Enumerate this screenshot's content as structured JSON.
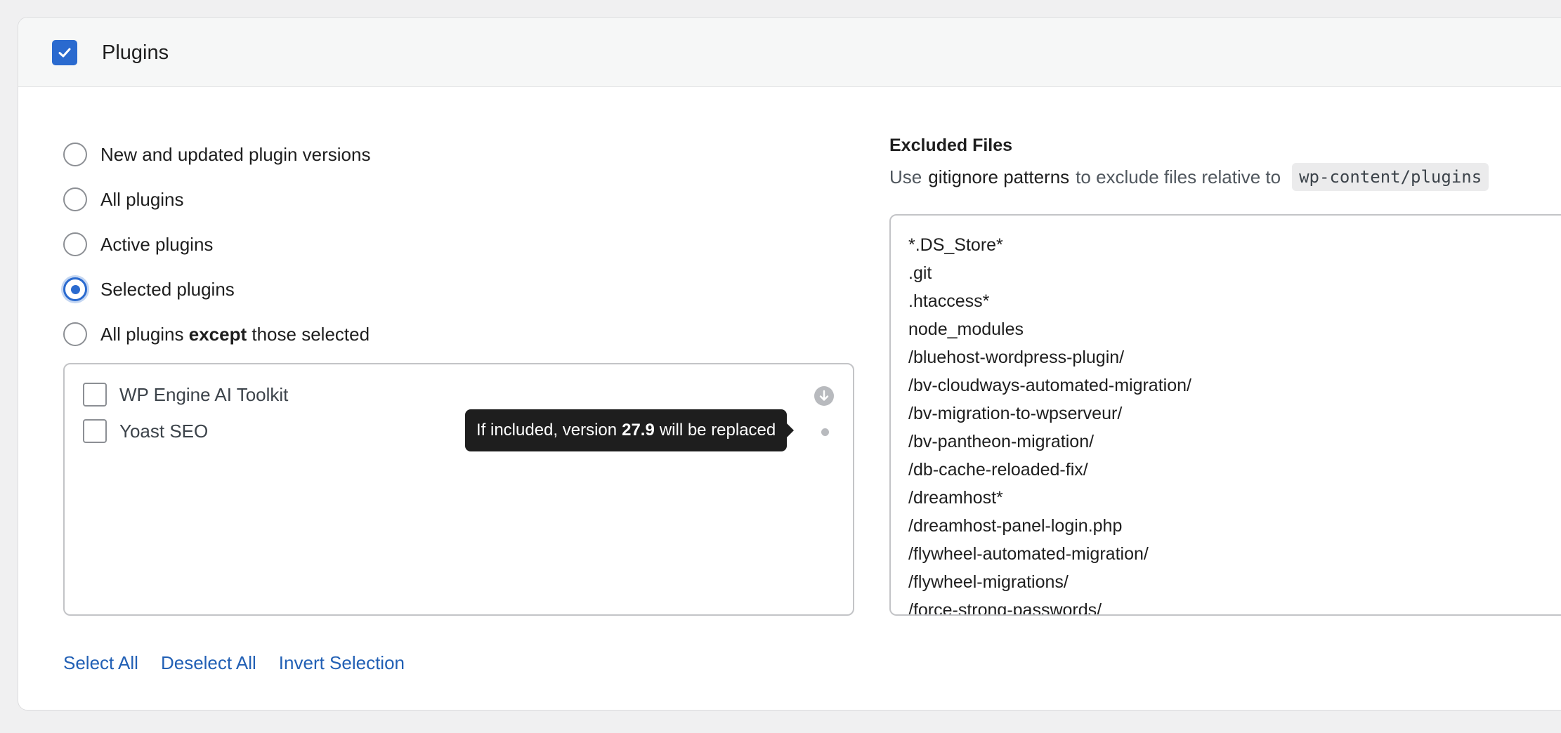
{
  "header": {
    "title": "Plugins",
    "checked": true
  },
  "mode_options": [
    {
      "label": "New and updated plugin versions",
      "selected": false
    },
    {
      "label": "All plugins",
      "selected": false
    },
    {
      "label": "Active plugins",
      "selected": false
    },
    {
      "label": "Selected plugins",
      "selected": true
    },
    {
      "label_before": "All plugins",
      "label_bold": "except",
      "label_after": "those selected",
      "selected": false
    }
  ],
  "plugins": [
    {
      "name": "WP Engine AI Toolkit",
      "checked": false,
      "icon": "download-circle-icon"
    },
    {
      "name": "Yoast SEO",
      "checked": false,
      "icon": "dot-icon"
    }
  ],
  "tooltip": {
    "prefix": "If included, version",
    "version": "27.9",
    "suffix": "will be replaced"
  },
  "selection_links": {
    "select_all": "Select All",
    "deselect_all": "Deselect All",
    "invert": "Invert Selection"
  },
  "excluded_files": {
    "title": "Excluded Files",
    "desc_prefix": "Use",
    "desc_link": "gitignore patterns",
    "desc_middle": "to exclude files relative to",
    "path": "wp-content/plugins",
    "patterns": "*.DS_Store*\n.git\n.htaccess*\nnode_modules\n/bluehost-wordpress-plugin/\n/bv-cloudways-automated-migration/\n/bv-migration-to-wpserveur/\n/bv-pantheon-migration/\n/db-cache-reloaded-fix/\n/dreamhost*\n/dreamhost-panel-login.php\n/flywheel-automated-migration/\n/flywheel-migrations/\n/force-strong-passwords/"
  },
  "colors": {
    "accent": "#2a6acf",
    "link": "#2260b5",
    "tooltip_bg": "#1e1e1e"
  }
}
